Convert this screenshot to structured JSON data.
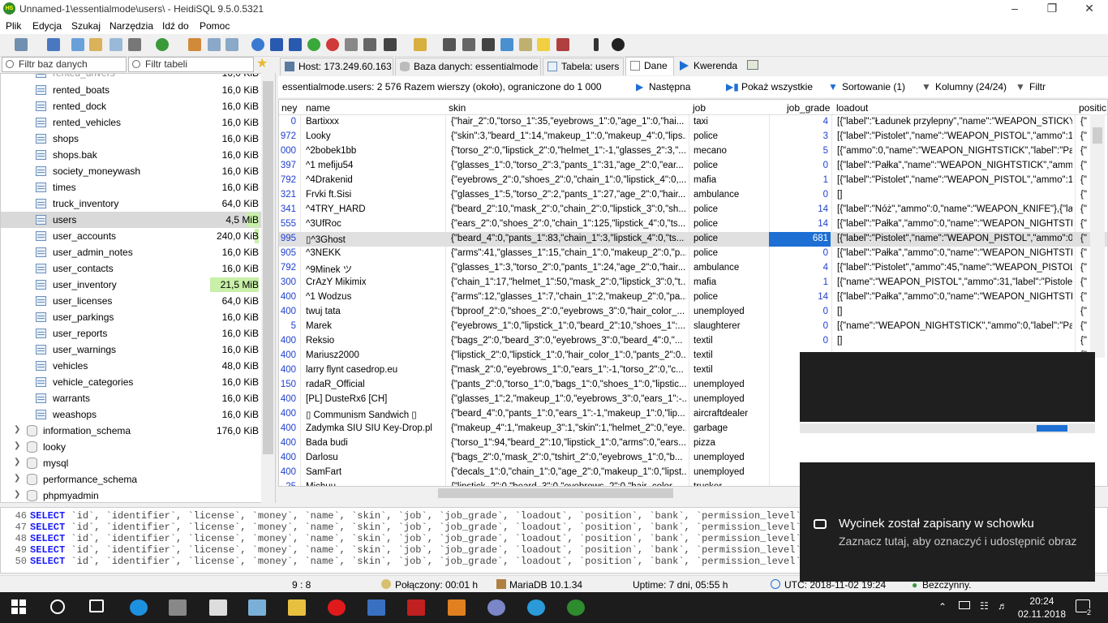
{
  "window": {
    "title": "Unnamed-1\\essentialmode\\users\\ - HeidiSQL 9.5.0.5321",
    "app_icon": "HS"
  },
  "menu": [
    "Plik",
    "Edycja",
    "Szukaj",
    "Narzędzia",
    "Idź do",
    "Pomoc"
  ],
  "filters": {
    "db_placeholder": "Filtr baz danych",
    "table_placeholder": "Filtr tabeli"
  },
  "tree": {
    "tables": [
      {
        "name": "rented_boats",
        "size": "16,0 KiB"
      },
      {
        "name": "rented_dock",
        "size": "16,0 KiB"
      },
      {
        "name": "rented_vehicles",
        "size": "16,0 KiB"
      },
      {
        "name": "shops",
        "size": "16,0 KiB"
      },
      {
        "name": "shops.bak",
        "size": "16,0 KiB"
      },
      {
        "name": "society_moneywash",
        "size": "16,0 KiB"
      },
      {
        "name": "times",
        "size": "16,0 KiB"
      },
      {
        "name": "truck_inventory",
        "size": "64,0 KiB"
      },
      {
        "name": "users",
        "size": "4,5 MiB"
      },
      {
        "name": "user_accounts",
        "size": "240,0 KiB"
      },
      {
        "name": "user_admin_notes",
        "size": "16,0 KiB"
      },
      {
        "name": "user_contacts",
        "size": "16,0 KiB"
      },
      {
        "name": "user_inventory",
        "size": "21,5 MiB"
      },
      {
        "name": "user_licenses",
        "size": "64,0 KiB"
      },
      {
        "name": "user_parkings",
        "size": "16,0 KiB"
      },
      {
        "name": "user_reports",
        "size": "16,0 KiB"
      },
      {
        "name": "user_warnings",
        "size": "16,0 KiB"
      },
      {
        "name": "vehicles",
        "size": "48,0 KiB"
      },
      {
        "name": "vehicle_categories",
        "size": "16,0 KiB"
      },
      {
        "name": "warrants",
        "size": "16,0 KiB"
      },
      {
        "name": "weashops",
        "size": "16,0 KiB"
      }
    ],
    "databases": [
      {
        "name": "information_schema",
        "size": "176,0 KiB"
      },
      {
        "name": "looky",
        "size": ""
      },
      {
        "name": "mysql",
        "size": ""
      },
      {
        "name": "performance_schema",
        "size": ""
      },
      {
        "name": "phpmyadmin",
        "size": ""
      }
    ]
  },
  "tabs": [
    "Host: 173.249.60.163",
    "Baza danych: essentialmode",
    "Tabela: users",
    "Dane",
    "Kwerenda"
  ],
  "infobar": {
    "summary": "essentialmode.users: 2 576 Razem wierszy (około), ograniczone do 1 000",
    "next": "Następna",
    "show_all": "Pokaż wszystkie",
    "sorting": "Sortowanie (1)",
    "columns": "Kolumny (24/24)",
    "filter": "Filtr"
  },
  "grid": {
    "headers": [
      "ney",
      "name",
      "skin",
      "job",
      "job_grade",
      "loadout",
      "positic"
    ],
    "rows": [
      {
        "id": "0",
        "name": "Bartixxx",
        "skin": "{\"hair_2\":0,\"torso_1\":35,\"eyebrows_1\":0,\"age_1\":0,\"hai...",
        "job": "taxi",
        "job_grade": "4",
        "loadout": "[{\"label\":\"Ładunek przylepny\",\"name\":\"WEAPON_STICKY..."
      },
      {
        "id": "972",
        "name": "Looky",
        "skin": "{\"skin\":3,\"beard_1\":14,\"makeup_1\":0,\"makeup_4\":0,\"lips...",
        "job": "police",
        "job_grade": "3",
        "loadout": "[{\"label\":\"Pistolet\",\"name\":\"WEAPON_PISTOL\",\"ammo\":1..."
      },
      {
        "id": "000",
        "name": "^2bobek1bb",
        "skin": "{\"torso_2\":0,\"lipstick_2\":0,\"helmet_1\":-1,\"glasses_2\":3,\"...",
        "job": "mecano",
        "job_grade": "5",
        "loadout": "[{\"ammo\":0,\"name\":\"WEAPON_NIGHTSTICK\",\"label\":\"Pał..."
      },
      {
        "id": "397",
        "name": "^1 mefiju54",
        "skin": "{\"glasses_1\":0,\"torso_2\":3,\"pants_1\":31,\"age_2\":0,\"ear...",
        "job": "police",
        "job_grade": "0",
        "loadout": "[{\"label\":\"Pałka\",\"name\":\"WEAPON_NIGHTSTICK\",\"ammo..."
      },
      {
        "id": "792",
        "name": "^4Drakenid",
        "skin": "{\"eyebrows_2\":0,\"shoes_2\":0,\"chain_1\":0,\"lipstick_4\":0,...",
        "job": "mafia",
        "job_grade": "1",
        "loadout": "[{\"label\":\"Pistolet\",\"name\":\"WEAPON_PISTOL\",\"ammo\":1..."
      },
      {
        "id": "321",
        "name": "Frvki ft.Sisi",
        "skin": "{\"glasses_1\":5,\"torso_2\":2,\"pants_1\":27,\"age_2\":0,\"hair...",
        "job": "ambulance",
        "job_grade": "0",
        "loadout": "[]"
      },
      {
        "id": "341",
        "name": "^4TRY_HARD",
        "skin": "{\"beard_2\":10,\"mask_2\":0,\"chain_2\":0,\"lipstick_3\":0,\"sh...",
        "job": "police",
        "job_grade": "14",
        "loadout": "[{\"label\":\"Nóż\",\"ammo\":0,\"name\":\"WEAPON_KNIFE\"},{\"la..."
      },
      {
        "id": "555",
        "name": "^3UfRoc",
        "skin": "{\"ears_2\":0,\"shoes_2\":0,\"chain_1\":125,\"lipstick_4\":0,\"ts...",
        "job": "police",
        "job_grade": "14",
        "loadout": "[{\"label\":\"Pałka\",\"ammo\":0,\"name\":\"WEAPON_NIGHTSTI..."
      },
      {
        "id": "995",
        "name": "▯^3Ghost",
        "skin": "{\"beard_4\":0,\"pants_1\":83,\"chain_1\":3,\"lipstick_4\":0,\"ts...",
        "job": "police",
        "job_grade": "681",
        "loadout": "[{\"label\":\"Pistolet\",\"name\":\"WEAPON_PISTOL\",\"ammo\":0..."
      },
      {
        "id": "905",
        "name": "^3NEKK",
        "skin": "{\"arms\":41,\"glasses_1\":15,\"chain_1\":0,\"makeup_2\":0,\"p...",
        "job": "police",
        "job_grade": "0",
        "loadout": "[{\"label\":\"Pałka\",\"ammo\":0,\"name\":\"WEAPON_NIGHTSTI..."
      },
      {
        "id": "792",
        "name": "^9Minek ツ",
        "skin": "{\"glasses_1\":3,\"torso_2\":0,\"pants_1\":24,\"age_2\":0,\"hair...",
        "job": "ambulance",
        "job_grade": "4",
        "loadout": "[{\"label\":\"Pistolet\",\"ammo\":45,\"name\":\"WEAPON_PISTOL..."
      },
      {
        "id": "300",
        "name": "CrAzY Mikimix",
        "skin": "{\"chain_1\":17,\"helmet_1\":50,\"mask_2\":0,\"lipstick_3\":0,\"t...",
        "job": "mafia",
        "job_grade": "1",
        "loadout": "[{\"name\":\"WEAPON_PISTOL\",\"ammo\":31,\"label\":\"Pistolet..."
      },
      {
        "id": "400",
        "name": "^1 Wodzus",
        "skin": "{\"arms\":12,\"glasses_1\":7,\"chain_1\":2,\"makeup_2\":0,\"pa...",
        "job": "police",
        "job_grade": "14",
        "loadout": "[{\"label\":\"Pałka\",\"ammo\":0,\"name\":\"WEAPON_NIGHTSTI..."
      },
      {
        "id": "400",
        "name": "twuj tata",
        "skin": "{\"bproof_2\":0,\"shoes_2\":0,\"eyebrows_3\":0,\"hair_color_...",
        "job": "unemployed",
        "job_grade": "0",
        "loadout": "[]"
      },
      {
        "id": "5",
        "name": "Marek",
        "skin": "{\"eyebrows_1\":0,\"lipstick_1\":0,\"beard_2\":10,\"shoes_1\":...",
        "job": "slaughterer",
        "job_grade": "0",
        "loadout": "[{\"name\":\"WEAPON_NIGHTSTICK\",\"ammo\":0,\"label\":\"Pał..."
      },
      {
        "id": "400",
        "name": "Reksio",
        "skin": "{\"bags_2\":0,\"beard_3\":0,\"eyebrows_3\":0,\"beard_4\":0,\"...",
        "job": "textil",
        "job_grade": "0",
        "loadout": "[]"
      },
      {
        "id": "400",
        "name": "Mariusz2000",
        "skin": "{\"lipstick_2\":0,\"lipstick_1\":0,\"hair_color_1\":0,\"pants_2\":0...",
        "job": "textil",
        "job_grade": "",
        "loadout": ""
      },
      {
        "id": "400",
        "name": "larry flynt casedrop.eu",
        "skin": "{\"mask_2\":0,\"eyebrows_1\":0,\"ears_1\":-1,\"torso_2\":0,\"c...",
        "job": "textil",
        "job_grade": "",
        "loadout": ""
      },
      {
        "id": "150",
        "name": "radaR_Official",
        "skin": "{\"pants_2\":0,\"torso_1\":0,\"bags_1\":0,\"shoes_1\":0,\"lipstic...",
        "job": "unemployed",
        "job_grade": "",
        "loadout": ""
      },
      {
        "id": "400",
        "name": "[PL] DusteRx6 [CH]",
        "skin": "{\"glasses_1\":2,\"makeup_1\":0,\"eyebrows_3\":0,\"ears_1\":-...",
        "job": "unemployed",
        "job_grade": "",
        "loadout": ""
      },
      {
        "id": "400",
        "name": "▯ Communism Sandwich ▯",
        "skin": "{\"beard_4\":0,\"pants_1\":0,\"ears_1\":-1,\"makeup_1\":0,\"lip...",
        "job": "aircraftdealer",
        "job_grade": "",
        "loadout": ""
      },
      {
        "id": "400",
        "name": "Zadymka SIU SIU Key-Drop.pl",
        "skin": "{\"makeup_4\":1,\"makeup_3\":1,\"skin\":1,\"helmet_2\":0,\"eye...",
        "job": "garbage",
        "job_grade": "",
        "loadout": ""
      },
      {
        "id": "400",
        "name": "Bada budi",
        "skin": "{\"torso_1\":94,\"beard_2\":10,\"lipstick_1\":0,\"arms\":0,\"ears...",
        "job": "pizza",
        "job_grade": "",
        "loadout": ""
      },
      {
        "id": "400",
        "name": "Darlosu",
        "skin": "{\"bags_2\":0,\"mask_2\":0,\"tshirt_2\":0,\"eyebrows_1\":0,\"b...",
        "job": "unemployed",
        "job_grade": "",
        "loadout": ""
      },
      {
        "id": "400",
        "name": "SamFart",
        "skin": "{\"decals_1\":0,\"chain_1\":0,\"age_2\":0,\"makeup_1\":0,\"lipst...",
        "job": "unemployed",
        "job_grade": "",
        "loadout": ""
      },
      {
        "id": "25",
        "name": "Michuu",
        "skin": "{\"lipstick_2\":0,\"beard_3\":0,\"eyebrows_2\":0,\"hair_color...",
        "job": "trucker",
        "job_grade": "",
        "loadout": ""
      }
    ]
  },
  "sqlog": {
    "lines": [
      "46",
      "47",
      "48",
      "49",
      "50"
    ],
    "keyword": "SELECT",
    "columns": "`id`, `identifier`, `license`, `money`, `name`, `skin`, `job`, `job_grade`, `loadout`, `position`, `bank`, `permission_level`, `g"
  },
  "status": {
    "position": "9 : 8",
    "connected": "Połączony: 00:01 h",
    "server": "MariaDB 10.1.34",
    "uptime": "Uptime: 7 dni, 05:55 h",
    "utc": "UTC: 2018-11-02 19:24",
    "idle": "Bezczynny."
  },
  "toast": {
    "title": "Wycinek został zapisany w schowku",
    "body": "Zaznacz tutaj, aby oznaczyć i udostępnić obraz"
  },
  "taskbar": {
    "time": "20:24",
    "date": "02.11.2018",
    "notifications": "2"
  }
}
